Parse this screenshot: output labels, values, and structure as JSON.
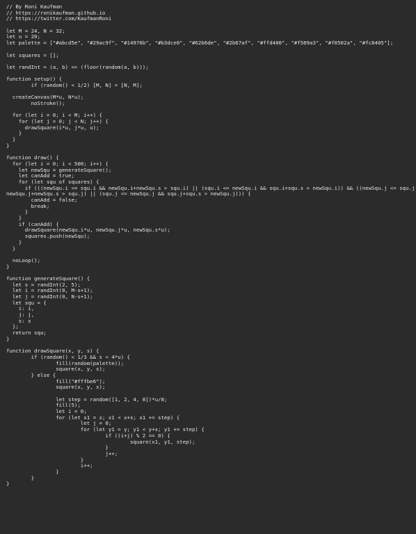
{
  "editor": {
    "lines": [
      "// By Roni Kaufman",
      "// https://ronikaufman.github.io",
      "// https://twitter.com/KaufmanRoni",
      "",
      "let M = 24, N = 32;",
      "let u = 20;",
      "let palette = [\"#abcd5e\", \"#29ac9f\", \"#14976b\", \"#b3dce0\", \"#62b6de\", \"#2b67af\", \"#ffd400\", \"#f589a3\", \"#f0502a\", \"#fc8405\"];",
      "",
      "let squares = [];",
      "",
      "let randInt = (a, b) => (floor(random(a, b)));",
      "",
      "function setup() {",
      "        if (random() < 1/2) [M, N] = [N, M];",
      "",
      "  createCanvas(M*u, N*u);",
      "        noStroke();",
      "",
      "  for (let i = 0; i < M; i++) {",
      "    for (let j = 0; j < N; j++) {",
      "      drawSquare(i*u, j*u, u);",
      "    }",
      "  }",
      "}",
      "",
      "function draw() {",
      "  for (let i = 0; i < 500; i++) {",
      "    let newSqu = generateSquare();",
      "    let canAdd = true;",
      "    for (let squ of squares) {",
      "      if (((newSqu.i <= squ.i && newSqu.i+newSqu.s > squ.i) || (squ.i <= newSqu.i && squ.i+squ.s > newSqu.i)) && ((newSqu.j <= squ.j &&",
      "newSqu.j+newSqu.s > squ.j) || (squ.j <= newSqu.j && squ.j+squ.s > newSqu.j))) {",
      "        canAdd = false;",
      "        break;",
      "      }",
      "    }",
      "    if (canAdd) {",
      "      drawSquare(newSqu.i*u, newSqu.j*u, newSqu.s*u);",
      "      squares.push(newSqu);",
      "    }",
      "  }",
      "",
      "  noLoop();",
      "}",
      "",
      "function generateSquare() {",
      "  let s = randInt(2, 5);",
      "  let i = randInt(0, M-s+1);",
      "  let j = randInt(0, N-s+1);",
      "  let squ = {",
      "    i: i,",
      "    j: j,",
      "    s: s",
      "  };",
      "  return squ;",
      "}",
      "",
      "function drawSquare(x, y, s) {",
      "        if (random() < 1/3 && s < 4*u) {",
      "                fill(random(palette));",
      "                square(x, y, s);",
      "        } else {",
      "                fill(\"#fffbe6\");",
      "                square(x, y, s);",
      "",
      "                let step = random([1, 2, 4, 8])*u/8;",
      "                fill(5);",
      "                let i = 0;",
      "                for (let x1 = x; x1 < x+s; x1 += step) {",
      "                        let j = 0;",
      "                        for (let y1 = y; y1 < y+s; y1 += step) {",
      "                                if ((i+j) % 2 == 0) {",
      "                                        square(x1, y1, step);",
      "                                }",
      "                                j++;",
      "                        }",
      "                        i++;",
      "                }",
      "        }",
      "}"
    ]
  }
}
